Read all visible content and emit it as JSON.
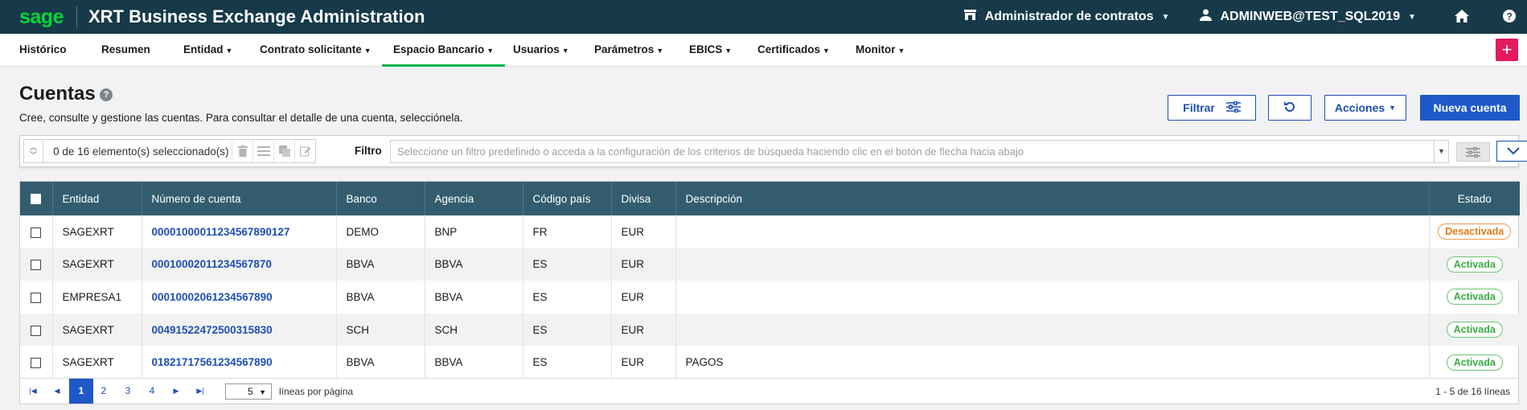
{
  "app": {
    "logo": "sage",
    "title": "XRT Business Exchange Administration",
    "contract_admin": "Administrador de contratos",
    "user": "ADMINWEB@TEST_SQL2019",
    "help": "?"
  },
  "menu": [
    {
      "label": "Histórico",
      "caret": false
    },
    {
      "label": "Resumen",
      "caret": false
    },
    {
      "label": "Entidad",
      "caret": true
    },
    {
      "label": "Contrato solicitante",
      "caret": true
    },
    {
      "label": "Espacio Bancario",
      "caret": true,
      "active": true
    },
    {
      "label": "Usuarios",
      "caret": true
    },
    {
      "label": "Parámetros",
      "caret": true
    },
    {
      "label": "EBICS",
      "caret": true
    },
    {
      "label": "Certificados",
      "caret": true
    },
    {
      "label": "Monitor",
      "caret": true
    }
  ],
  "plus_label": "+",
  "page": {
    "title": "Cuentas",
    "help_icon": "?",
    "description": "Cree, consulte y gestione las cuentas. Para consultar el detalle de una cuenta, selecciónela."
  },
  "actions": {
    "filter": "Filtrar",
    "actions": "Acciones",
    "new_account": "Nueva cuenta"
  },
  "toolbar": {
    "selected_count": "0 de 16 elemento(s) seleccionado(s)",
    "filter_label": "Filtro",
    "filter_placeholder": "Seleccione un filtro predefinido o acceda a la configuración de los criterios de búsqueda haciendo clic en el botón de flecha hacia abajo"
  },
  "table": {
    "headers": [
      "Entidad",
      "Número de cuenta",
      "Banco",
      "Agencia",
      "Código país",
      "Divisa",
      "Descripción",
      "Estado"
    ],
    "rows": [
      {
        "entidad": "SAGEXRT",
        "numero": "0000100001123456789012 7",
        "banco": "DEMO",
        "agencia": "BNP",
        "pais": "FR",
        "divisa": "EUR",
        "descripcion": "",
        "estado": "Desactivada",
        "activo": false
      },
      {
        "entidad": "SAGEXRT",
        "numero": "00010002011234567870",
        "banco": "BBVA",
        "agencia": "BBVA",
        "pais": "ES",
        "divisa": "EUR",
        "descripcion": "",
        "estado": "Activada",
        "activo": true
      },
      {
        "entidad": "EMPRESA1",
        "numero": "00010002061234567890",
        "banco": "BBVA",
        "agencia": "BBVA",
        "pais": "ES",
        "divisa": "EUR",
        "descripcion": "",
        "estado": "Activada",
        "activo": true
      },
      {
        "entidad": "SAGEXRT",
        "numero": "00491522472500315830",
        "banco": "SCH",
        "agencia": "SCH",
        "pais": "ES",
        "divisa": "EUR",
        "descripcion": "",
        "estado": "Activada",
        "activo": true
      },
      {
        "entidad": "SAGEXRT",
        "numero": "01821717561234567890",
        "banco": "BBVA",
        "agencia": "BBVA",
        "pais": "ES",
        "divisa": "EUR",
        "descripcion": "PAGOS",
        "estado": "Activada",
        "activo": true
      }
    ]
  },
  "pager": {
    "pages": [
      "1",
      "2",
      "3",
      "4"
    ],
    "current": "1",
    "rows_per_page": "5",
    "rows_label": "líneas por página",
    "range": "1 - 5 de 16 líneas"
  },
  "colors": {
    "topbar": "#163a4a",
    "brand_green": "#00d639",
    "primary": "#1e59c7",
    "header": "#335d6e",
    "plus": "#e5195e"
  }
}
